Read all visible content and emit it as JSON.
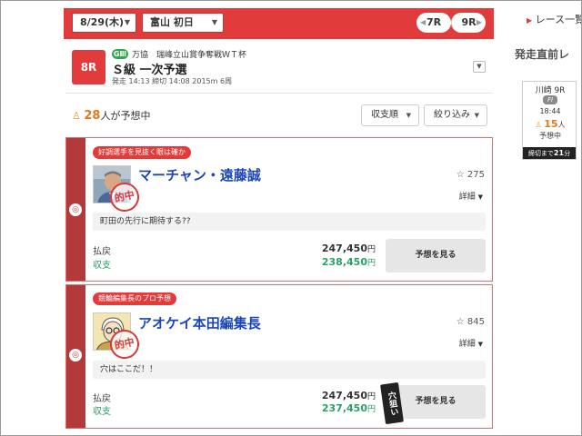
{
  "nav": {
    "date": "8/29(木)",
    "track": "富山 初日",
    "prev_race": "7R",
    "next_race": "9R"
  },
  "race": {
    "number": "8R",
    "grade": "GⅢ",
    "association_title": "万協　瑞峰立山賞争奪戦ＷＴ杯",
    "title": "Ｓ級 一次予選",
    "info": "発走 14:13 締切 14:08 2015m 6周"
  },
  "summary": {
    "count": "28",
    "count_suffix": "人が予想中",
    "sort_label": "収支順",
    "filter_label": "絞り込み"
  },
  "cards": [
    {
      "tag": "好調選手を見抜く眼は確か",
      "author": "マーチャン・遠藤誠",
      "hit_stamp": "的中",
      "favorites": "275",
      "detail": "詳細",
      "comment": "町田の先行に期待する??",
      "payout_label": "払戻",
      "profit_label": "収支",
      "payout": "247,450",
      "profit": "238,450",
      "unit": "円",
      "button": "予想を見る"
    },
    {
      "tag": "競輪編集長のプロ予想",
      "author": "アオケイ本田編集長",
      "hit_stamp": "的中",
      "favorites": "845",
      "detail": "詳細",
      "comment": "穴はここだ！！",
      "payout_label": "払戻",
      "profit_label": "収支",
      "payout": "247,450",
      "profit": "237,450",
      "unit": "円",
      "button": "予想を見る",
      "badge": "穴狙い"
    }
  ],
  "sidebar": {
    "race_list": "レース一覧",
    "upcoming_title": "発走直前レ",
    "track": "川崎 9R",
    "grade": "FⅠ",
    "time": "18:44",
    "count": "15",
    "count_suffix": "人",
    "predicting": "予想中",
    "deadline_prefix": "締切まで",
    "deadline_value": "21",
    "deadline_suffix": "分"
  },
  "colors": {
    "brand_red": "#e23b3b",
    "strip_red": "#b33a3a",
    "author_blue": "#1a46b8",
    "profit_green": "#29a06a",
    "count_orange": "#e07a1d"
  }
}
